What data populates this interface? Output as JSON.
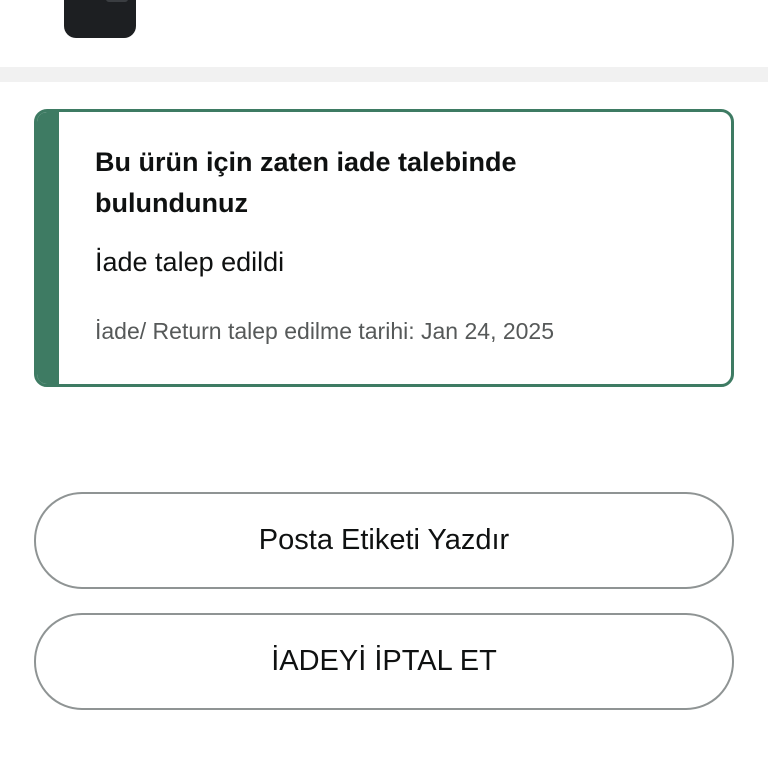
{
  "product": {
    "image_icon": "product-thumbnail"
  },
  "return_status": {
    "title": "Bu ürün için zaten iade talebinde bulundunuz",
    "status": "İade talep edildi",
    "date_text": "İade/ Return talep edilme tarihi: Jan 24, 2025",
    "accent_color": "#3e7b63"
  },
  "actions": {
    "print_label": "Posta Etiketi Yazdır",
    "cancel_return": "İADEYİ İPTAL ET"
  }
}
